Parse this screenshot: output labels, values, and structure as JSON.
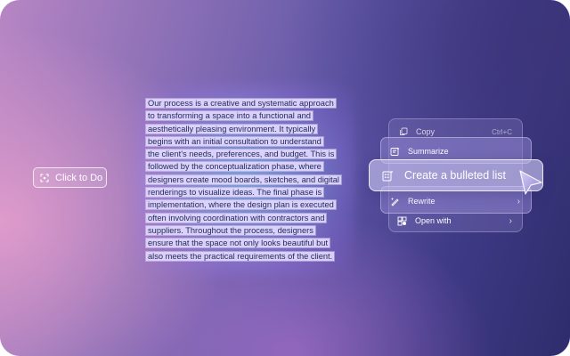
{
  "click_to_do": {
    "label": "Click to Do",
    "icon": "click-to-do-icon"
  },
  "selected_text": {
    "lines": [
      "Our process is a creative and systematic approach",
      "to transforming a space into a functional and",
      "aesthetically pleasing environment. It typically",
      "begins with an initial consultation to understand",
      "the client's needs, preferences, and budget. This is",
      "followed by the conceptualization phase, where",
      "designers create mood boards, sketches, and digital",
      "renderings to visualize ideas. The final phase is",
      "implementation, where the design plan is executed",
      "often involving coordination with contractors and",
      "suppliers. Throughout the process, designers",
      "ensure that the space not only looks beautiful but",
      "also meets the practical requirements of the client."
    ]
  },
  "context_menu": {
    "copy": {
      "label": "Copy",
      "shortcut": "Ctrl+C",
      "icon": "copy-icon"
    },
    "summarize": {
      "label": "Summarize",
      "icon": "summarize-icon"
    },
    "bulleted_list": {
      "label": "Create a bulleted list",
      "icon": "bulleted-list-icon"
    },
    "rewrite": {
      "label": "Rewrite",
      "icon": "rewrite-icon",
      "chevron": "›"
    },
    "open_with": {
      "label": "Open with",
      "icon": "open-with-icon",
      "chevron": "›"
    }
  }
}
